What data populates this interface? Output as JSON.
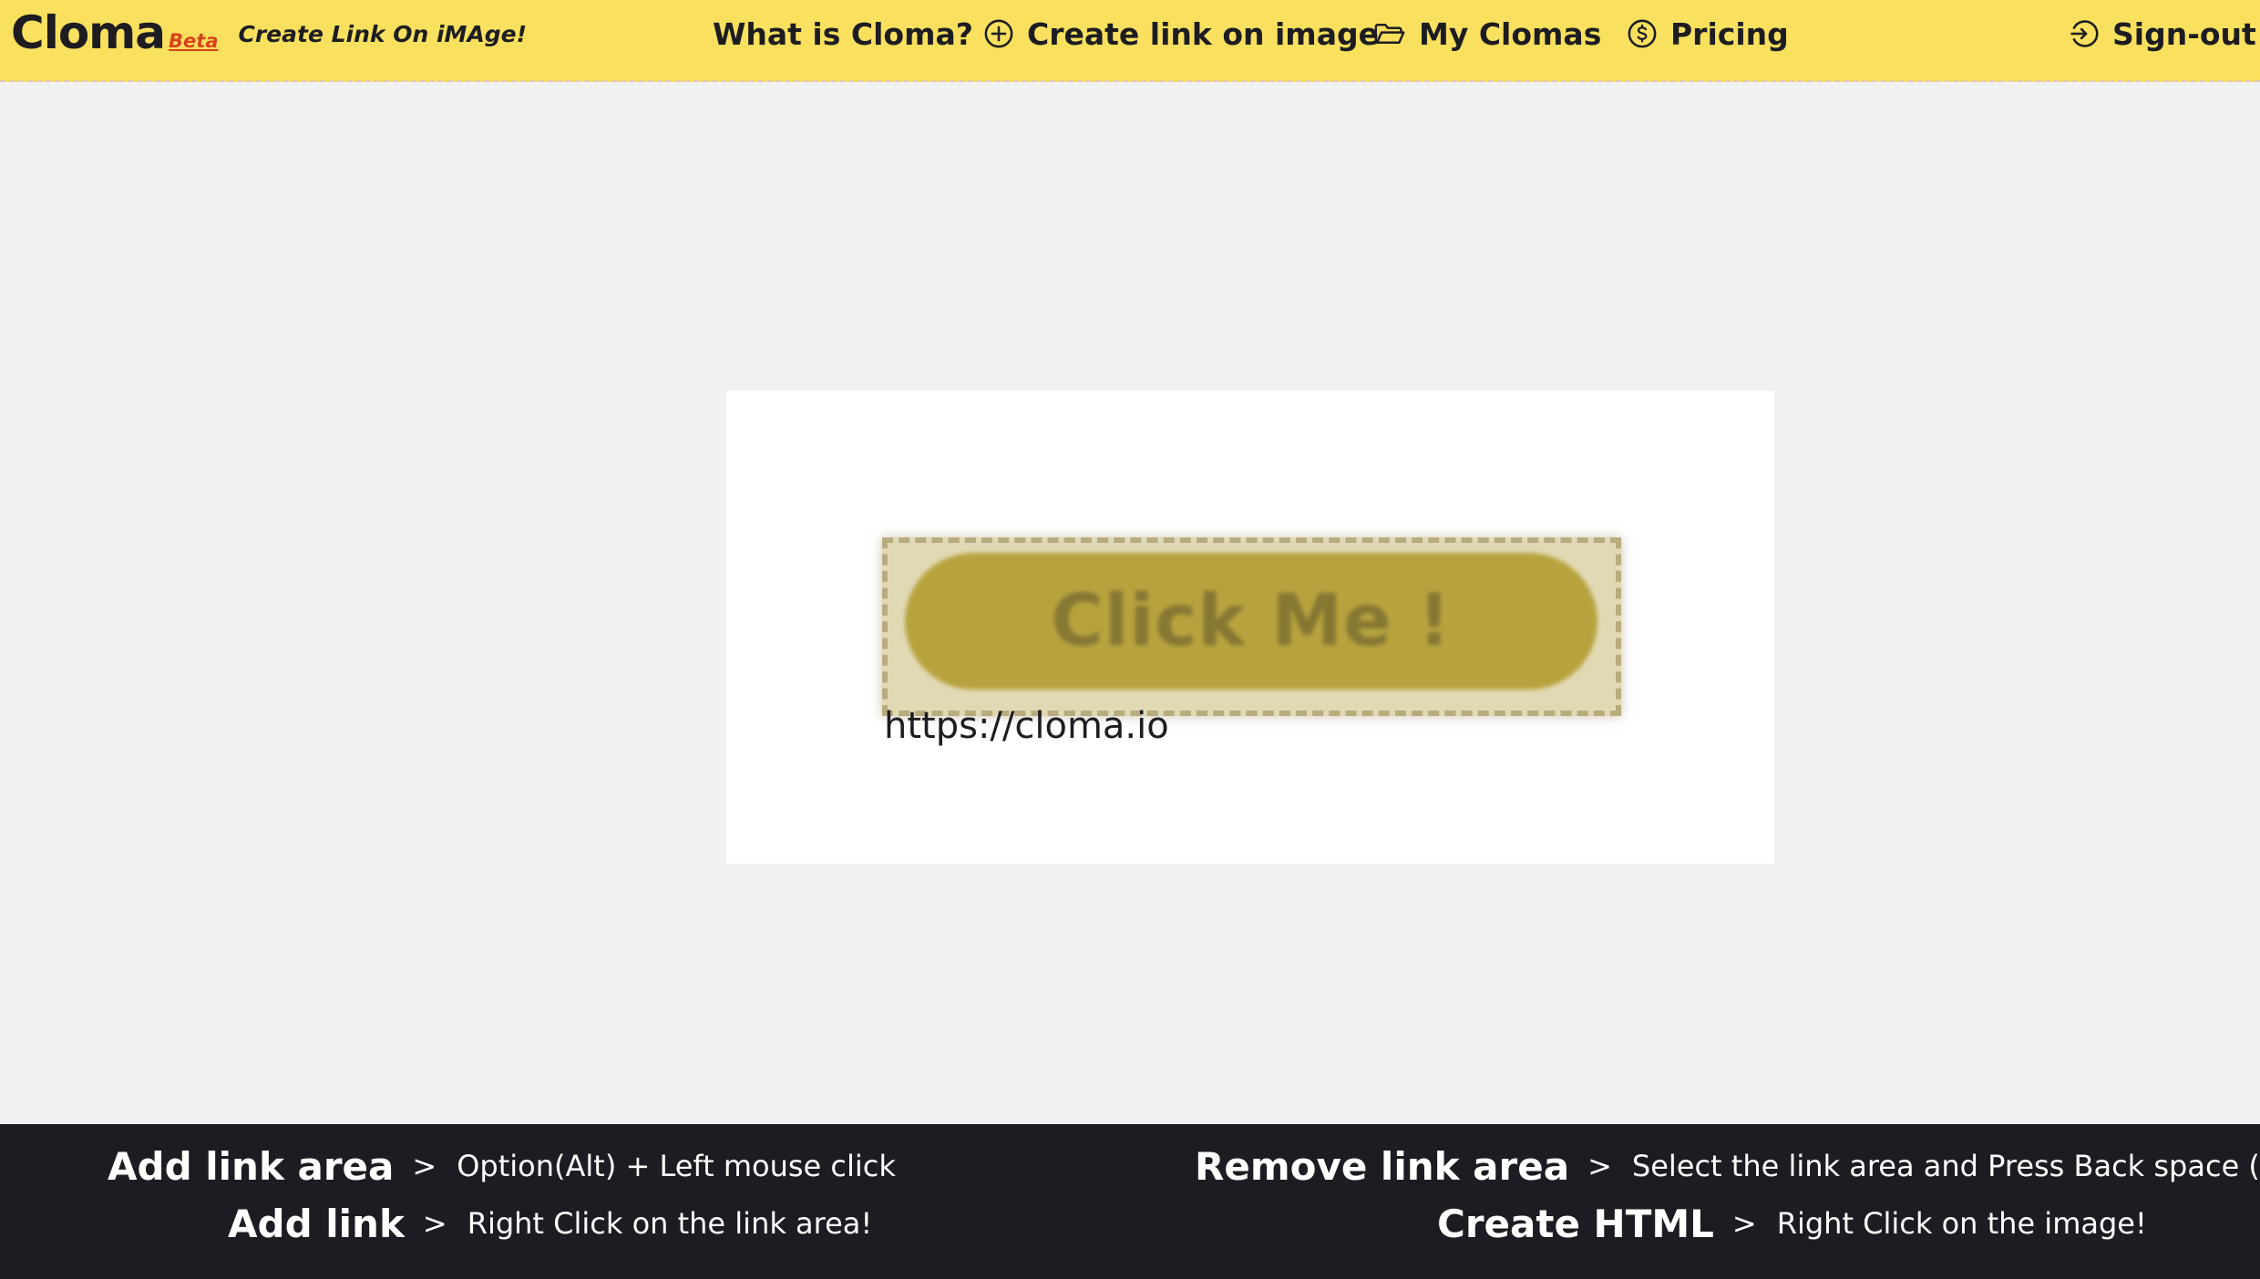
{
  "header": {
    "brand": "Cloma",
    "beta": "Beta",
    "tagline": "Create Link On iMAge!",
    "nav": {
      "what_is": "What is Cloma?",
      "create_link": "Create link on image",
      "my_clomas": "My Clomas",
      "pricing": "Pricing",
      "sign_out": "Sign-out"
    },
    "accent_color": "#f9e05e"
  },
  "canvas": {
    "image_button_text": "Click Me !",
    "link_url": "https://cloma.io"
  },
  "footer": {
    "hints": [
      {
        "action": "Add link area",
        "desc": "Option(Alt) + Left mouse click"
      },
      {
        "action": "Add link",
        "desc": "Right Click on the link area!"
      },
      {
        "action": "Remove link area",
        "desc": "Select the link area and Press Back space (⌫)"
      },
      {
        "action": "Create HTML",
        "desc": "Right Click on the image!"
      }
    ],
    "arrow": ">",
    "background_color": "#1c1c22"
  },
  "icons": {
    "create_link": "plus-circle-icon",
    "my_clomas": "folder-open-icon",
    "pricing": "dollar-circle-icon",
    "sign_out": "sign-in-arrow-icon"
  }
}
